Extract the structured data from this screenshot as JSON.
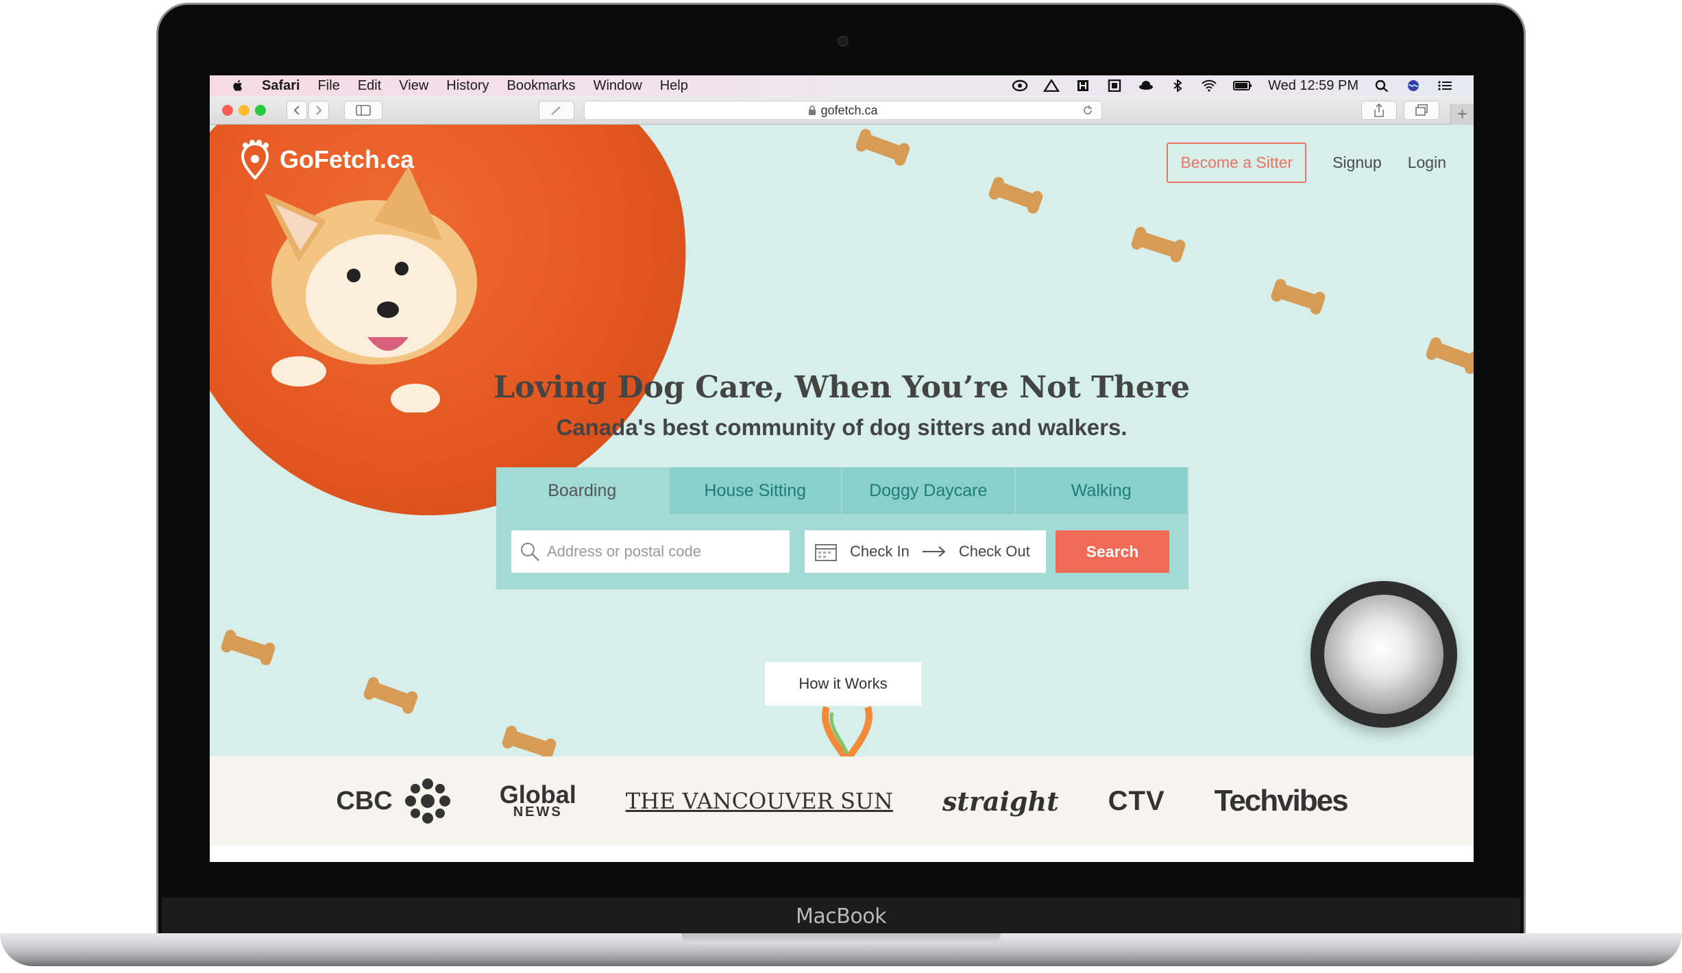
{
  "menubar": {
    "app": "Safari",
    "menus": [
      "File",
      "Edit",
      "View",
      "History",
      "Bookmarks",
      "Window",
      "Help"
    ],
    "clock": "Wed 12:59 PM"
  },
  "browser": {
    "url": "gofetch.ca"
  },
  "site": {
    "logo_text": "GoFetch.ca",
    "nav": {
      "become_sitter": "Become a Sitter",
      "signup": "Signup",
      "login": "Login"
    },
    "hero_title": "Loving Dog Care, When You’re Not There",
    "hero_subtitle": "Canada's best community of dog sitters and walkers.",
    "tabs": [
      "Boarding",
      "House Sitting",
      "Doggy Daycare",
      "Walking"
    ],
    "search": {
      "address_placeholder": "Address or postal code",
      "check_in": "Check In",
      "check_out": "Check Out",
      "button": "Search"
    },
    "how_it_works": "How it Works",
    "press": {
      "cbc": "CBC",
      "global": "Global",
      "global_sub": "NEWS",
      "sun": "THE VANCOUVER SUN",
      "straight": "straight",
      "ctv": "CTV",
      "techvibes": "Techvibes"
    },
    "accent": "#ef6a57",
    "teal": "#88d0c9"
  },
  "device": {
    "label": "MacBook"
  }
}
